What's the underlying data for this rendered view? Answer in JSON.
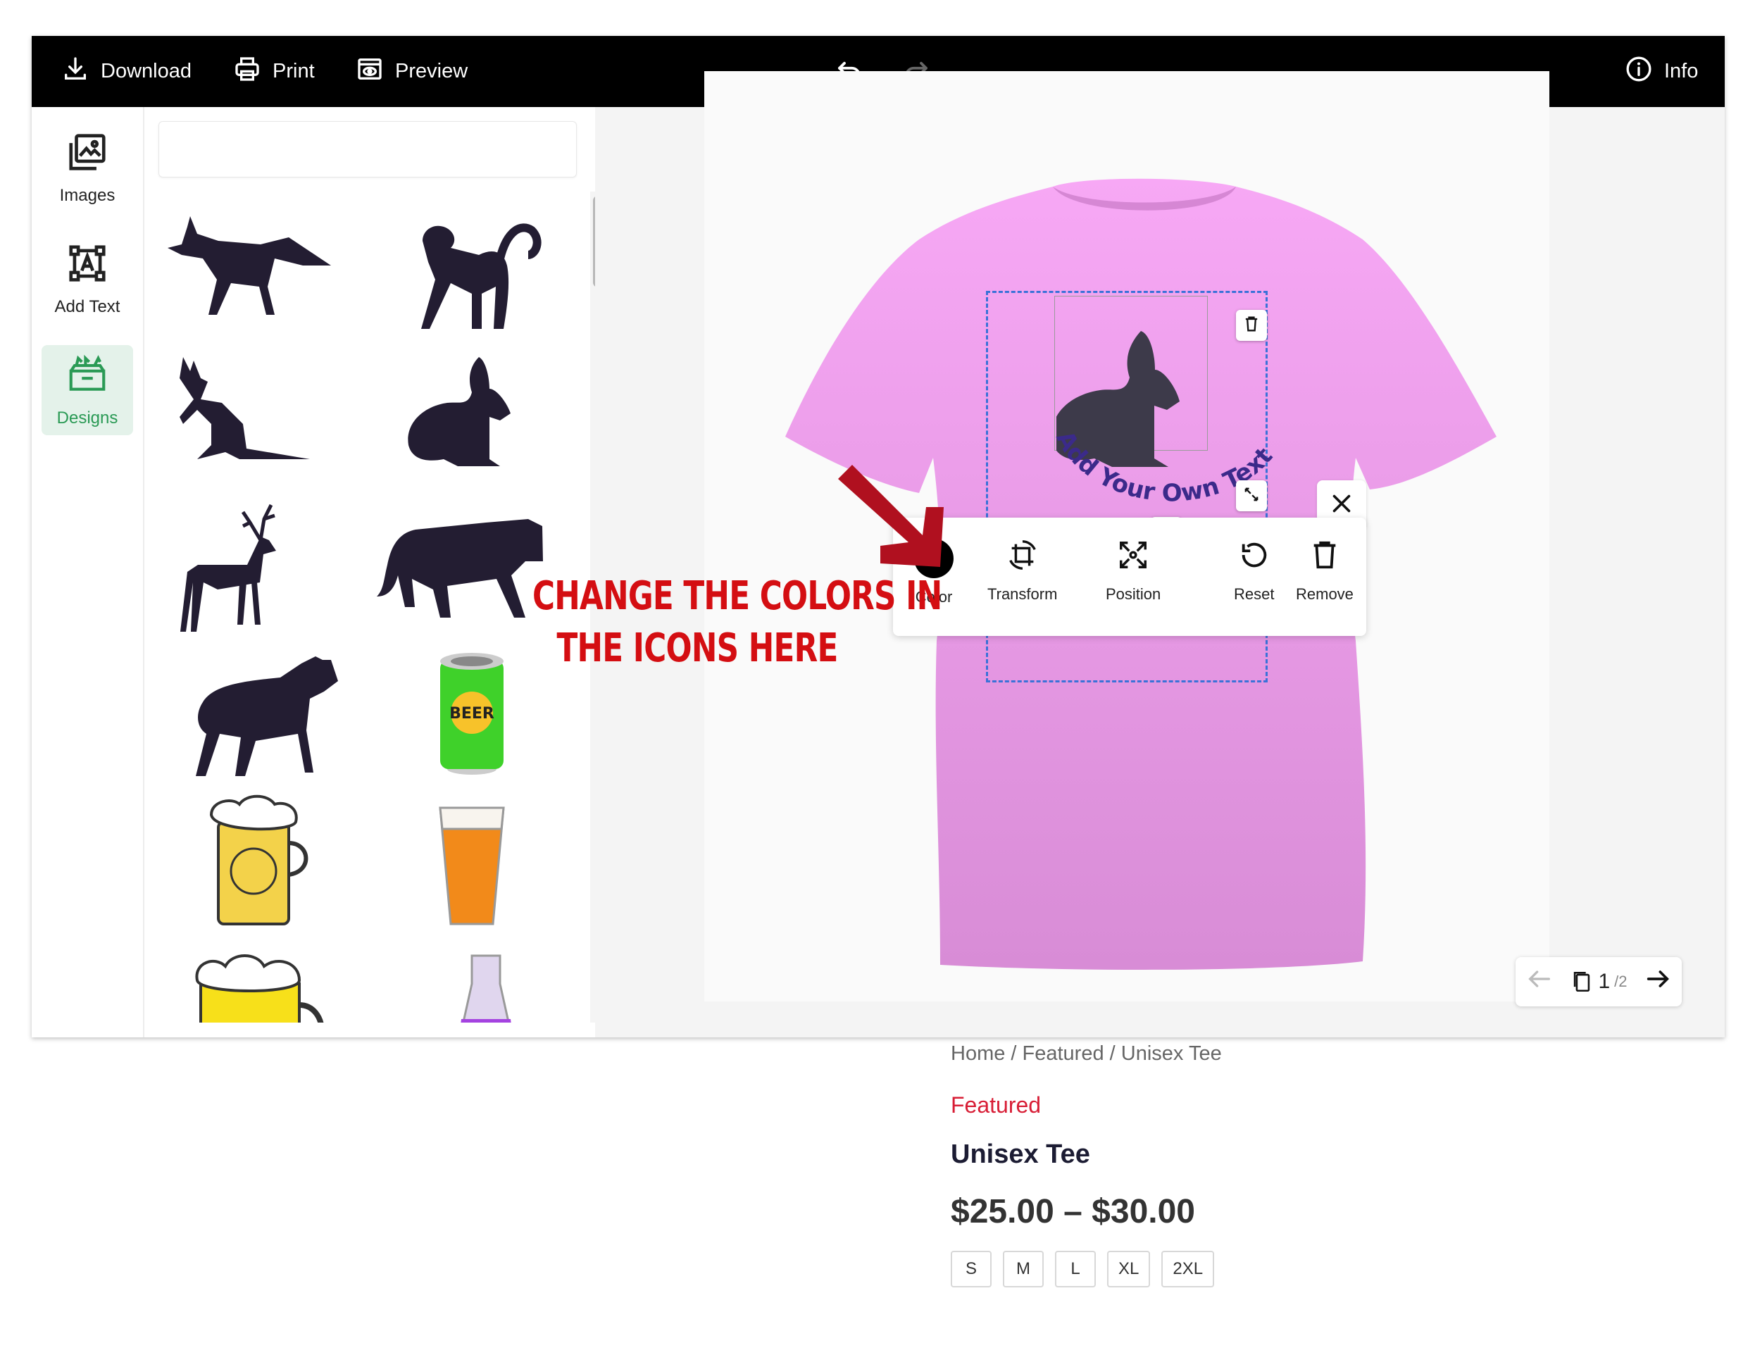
{
  "toolbar": {
    "download_label": "Download",
    "print_label": "Print",
    "preview_label": "Preview",
    "info_label": "Info"
  },
  "sidebar": {
    "items": [
      {
        "label": "Images",
        "icon": "images-icon",
        "active": false
      },
      {
        "label": "Add Text",
        "icon": "add-text-icon",
        "active": false
      },
      {
        "label": "Designs",
        "icon": "designs-icon",
        "active": true
      }
    ]
  },
  "designs_panel": {
    "search_value": "",
    "items": [
      "fox",
      "monkey",
      "kangaroo",
      "rabbit",
      "deer",
      "tiger",
      "wolf",
      "beer-can",
      "beer-mug",
      "beer-glass",
      "beer-stein",
      "pitcher"
    ]
  },
  "canvas": {
    "curved_text": "Add Your Own Text",
    "shirt_color": "#f2a6f2",
    "design_color": "#3a3a4a",
    "text_color": "#3b2a8a"
  },
  "edit_toolbar": {
    "color_label": "Color",
    "transform_label": "Transform",
    "position_label": "Position",
    "reset_label": "Reset",
    "remove_label": "Remove",
    "selected_color": "#000000"
  },
  "annotation": {
    "line1": "CHANGE THE COLORS IN",
    "line2": "THE ICONS HERE",
    "color": "#d40e12"
  },
  "pager": {
    "current": "1",
    "total": "/2"
  },
  "product": {
    "breadcrumb": "Home / Featured / Unisex Tee",
    "category": "Featured",
    "title": "Unisex Tee",
    "price": "$25.00 – $30.00",
    "sizes": [
      "S",
      "M",
      "L",
      "XL",
      "2XL"
    ]
  }
}
